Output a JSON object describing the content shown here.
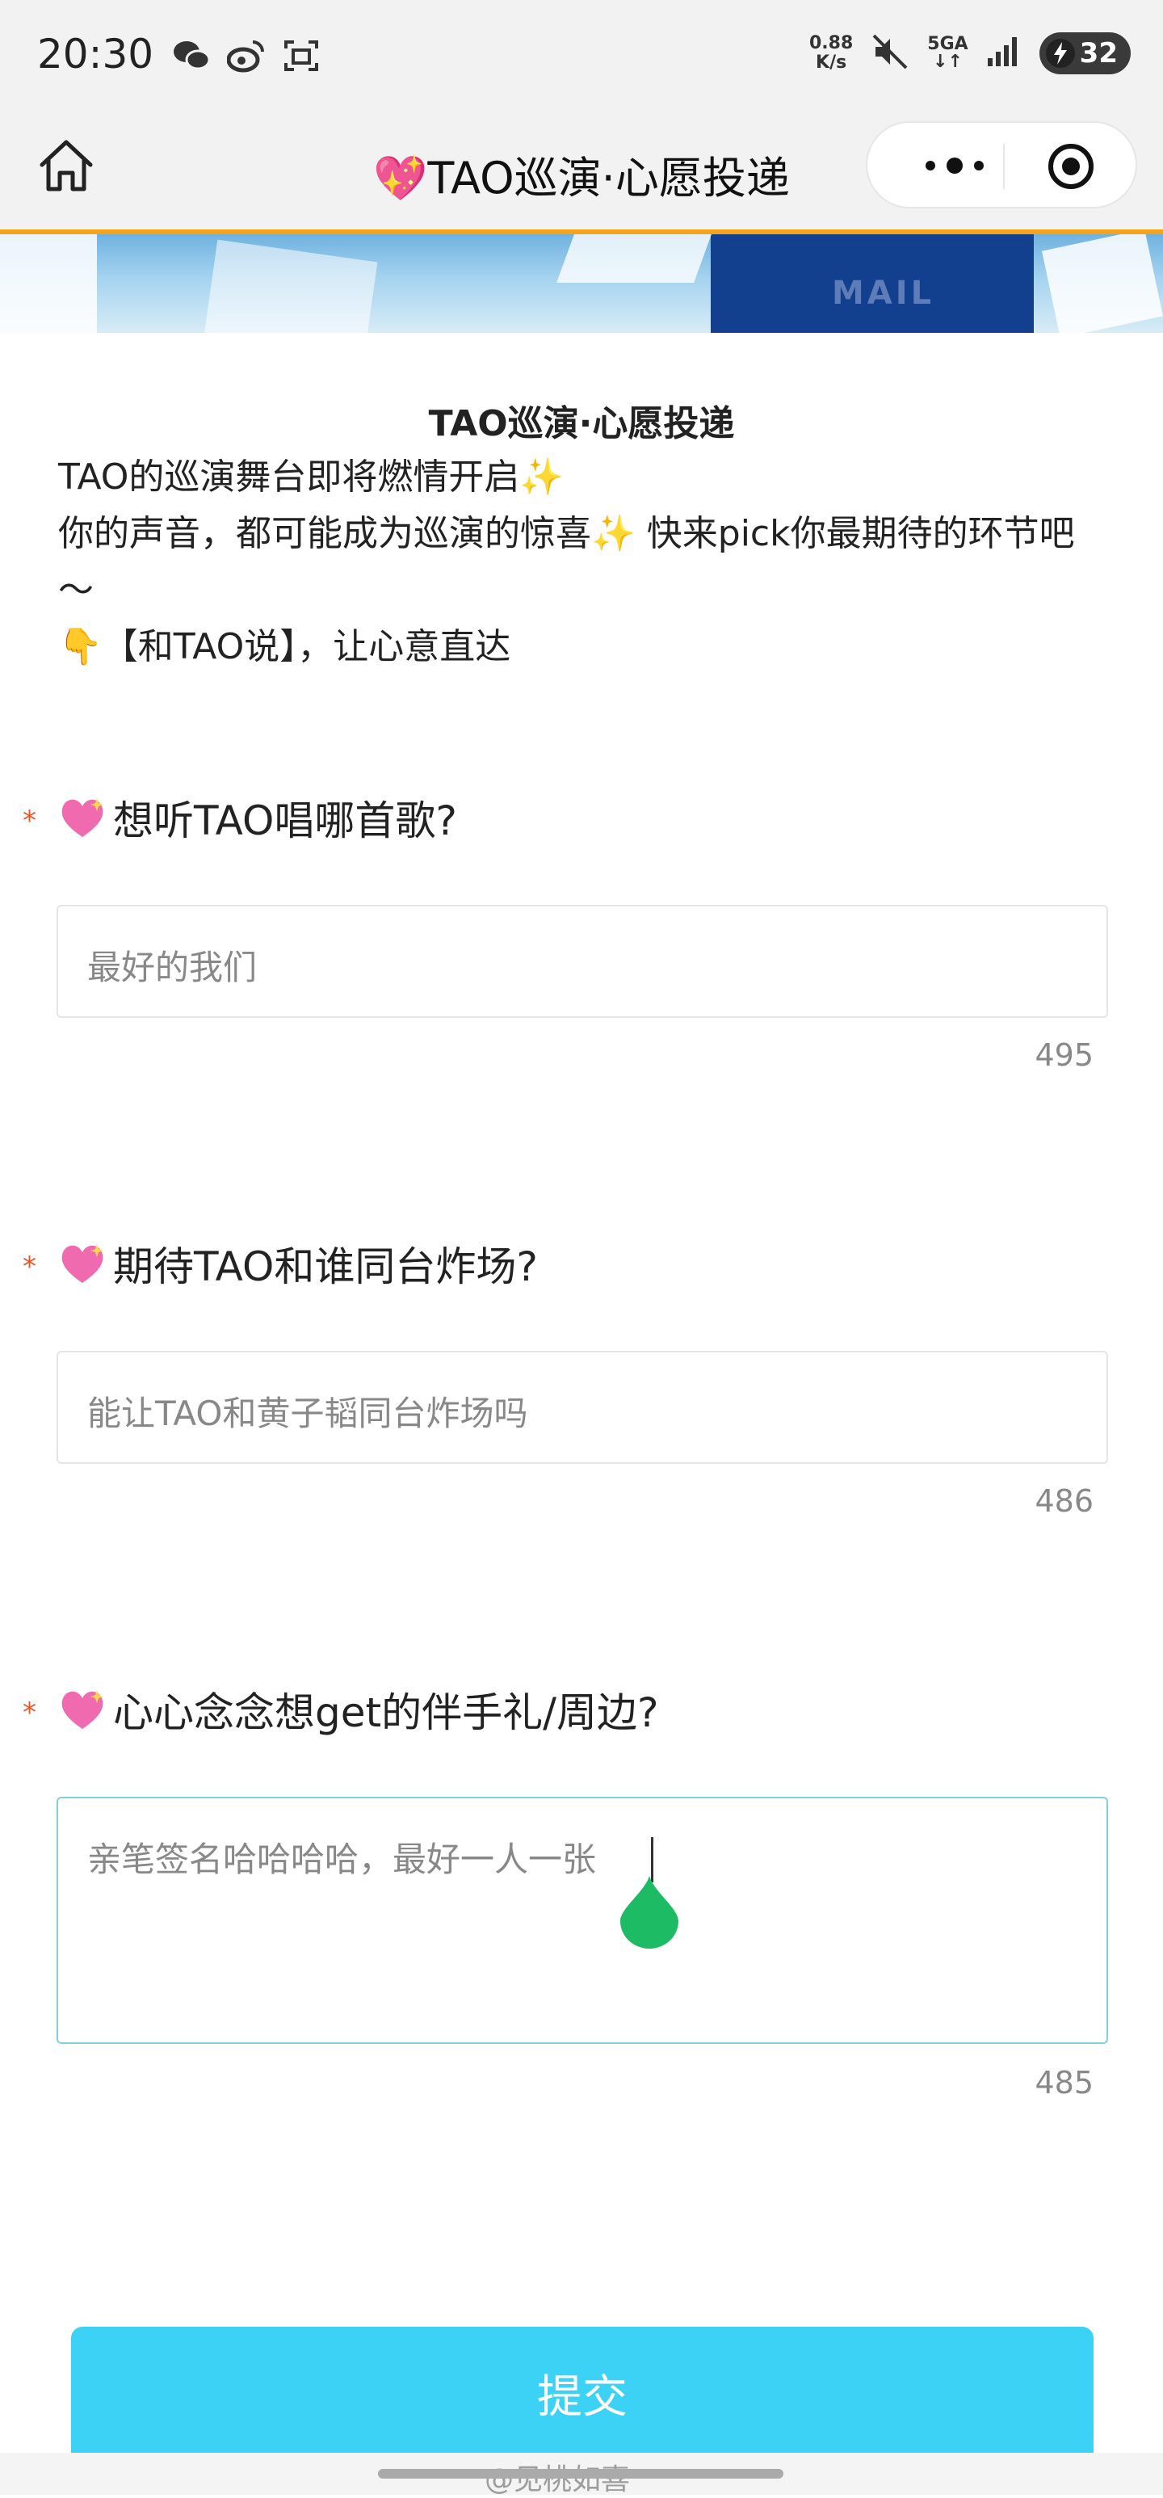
{
  "status_bar": {
    "time": "20:30",
    "net_speed_value": "0.88",
    "net_speed_unit": "K/s",
    "network": "5GA",
    "battery": "32"
  },
  "nav": {
    "title": "💖TAO巡演·心愿投递"
  },
  "banner": {
    "mail_text": "MAIL"
  },
  "intro": {
    "title": "TAO巡演·心愿投递",
    "line1": "TAO的巡演舞台即将燃情开启✨",
    "line2": "你的声音，都可能成为巡演的惊喜✨ 快来pick你最期待的环节吧～",
    "line3": "👇【和TAO说】，让心意直达"
  },
  "questions": [
    {
      "required_mark": "*",
      "label": "想听TAO唱哪首歌?",
      "value": "最好的我们",
      "counter": "495"
    },
    {
      "required_mark": "*",
      "label": "期待TAO和谁同台炸场?",
      "value": "能让TAO和黄子韬同台炸场吗",
      "counter": "486"
    },
    {
      "required_mark": "*",
      "label": "心心念念想get的伴手礼/周边?",
      "value": "亲笔签名哈哈哈哈，最好一人一张",
      "counter": "485"
    }
  ],
  "submit_label": "提交",
  "watermark": "@见桃如喜",
  "colors": {
    "accent_orange": "#f3a31c",
    "submit_blue": "#3bd2f5",
    "required_red": "#e0582a",
    "focus_border": "#7cd3de"
  }
}
